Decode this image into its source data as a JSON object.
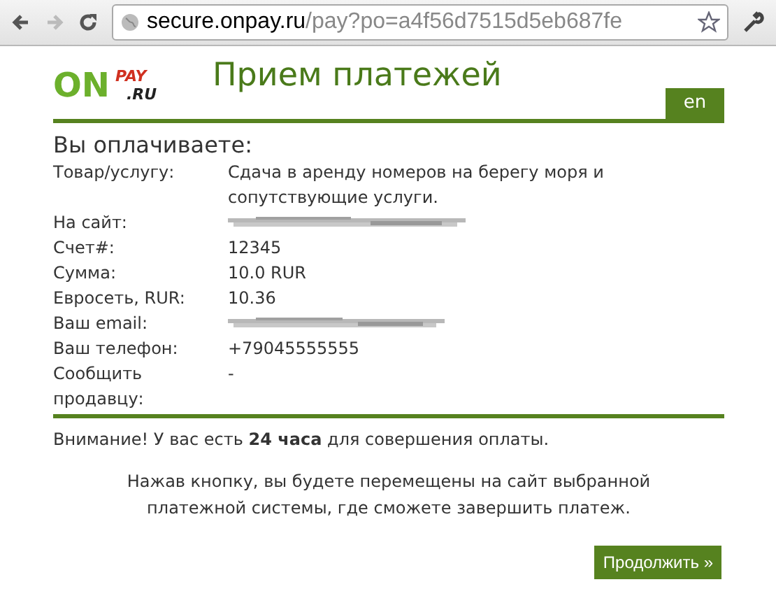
{
  "browser": {
    "url_host": "secure.onpay.ru",
    "url_path": "/pay?po=a4f56d7515d5eb687fe"
  },
  "header": {
    "logo": {
      "on": "ON",
      "pay": "PAY",
      "domain": ".RU"
    },
    "title": "Прием платежей",
    "language_button": "en"
  },
  "section_title": "Вы оплачиваете:",
  "details": [
    {
      "label": "Товар/услугу:",
      "kind": "text",
      "value": "Сдача в аренду номеров на берегу моря и сопутствующие услуги."
    },
    {
      "label": "На сайт:",
      "kind": "redacted"
    },
    {
      "label": "Счет#:",
      "kind": "text",
      "value": "12345"
    },
    {
      "label": "Сумма:",
      "kind": "text",
      "value": "10.0 RUR"
    },
    {
      "label": "Евросеть, RUR:",
      "kind": "text",
      "value": "10.36"
    },
    {
      "label": "Ваш email:",
      "kind": "redacted"
    },
    {
      "label": "Ваш телефон:",
      "kind": "text",
      "value": "+79045555555"
    },
    {
      "label": "Сообщить продавцу:",
      "kind": "text",
      "value": "-"
    }
  ],
  "notice": "Внимание! У вас есть **24 часа** для совершения оплаты.",
  "info": "Нажав кнопку, вы будете перемещены на сайт выбранной платежной системы, где сможете завершить платеж.",
  "continue_button": "Продолжить »"
}
